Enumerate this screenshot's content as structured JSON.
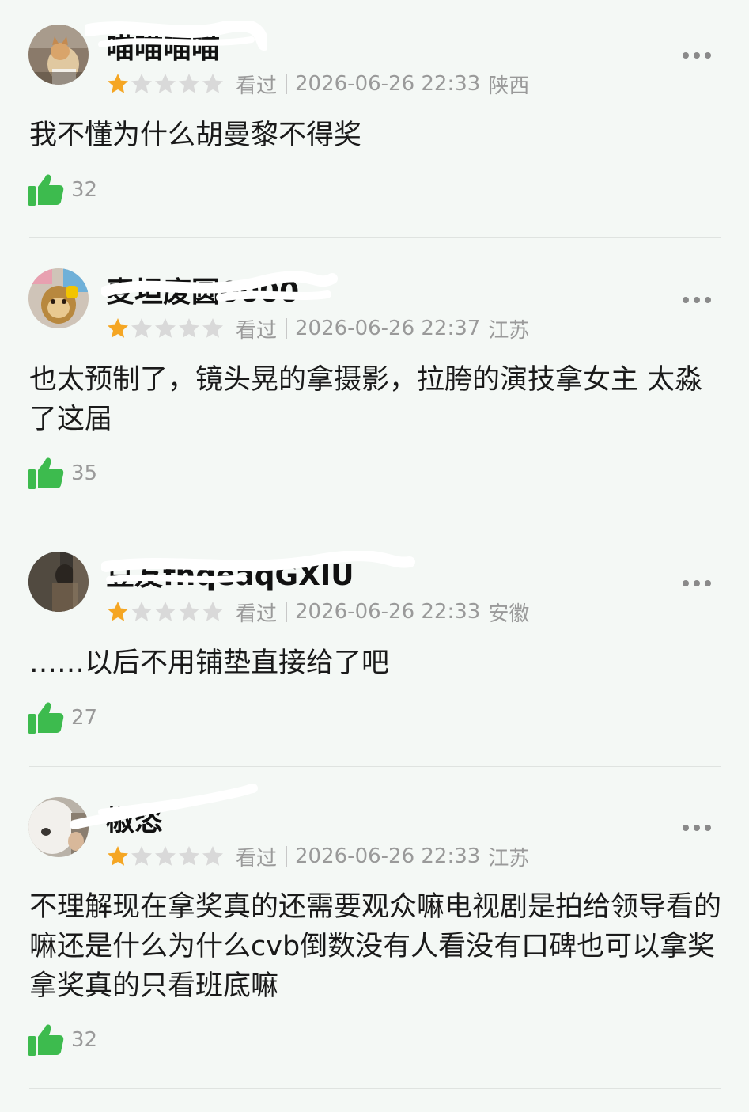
{
  "comments": [
    {
      "username": "喵喵喵喵",
      "status": "看过",
      "time": "2026-06-26 22:33",
      "location": "陕西",
      "rating": 1,
      "rating_max": 5,
      "text": "我不懂为什么胡曼黎不得奖",
      "likes": "32",
      "avatar_icon": "cat-photo-avatar"
    },
    {
      "username": "麦坦废圆0000",
      "status": "看过",
      "time": "2026-06-26 22:37",
      "location": "江苏",
      "rating": 1,
      "rating_max": 5,
      "text": "也太预制了，镜头晃的拿摄影，拉胯的演技拿女主 太淼了这届",
      "likes": "35",
      "avatar_icon": "cartoon-monkey-avatar"
    },
    {
      "username": "豆友fnqeaqGXIU",
      "status": "看过",
      "time": "2026-06-26 22:33",
      "location": "安徽",
      "rating": 1,
      "rating_max": 5,
      "text": "……以后不用铺垫直接给了吧",
      "likes": "27",
      "avatar_icon": "dark-photo-avatar"
    },
    {
      "username": "椒恣",
      "status": "看过",
      "time": "2026-06-26 22:33",
      "location": "江苏",
      "rating": 1,
      "rating_max": 5,
      "text": "不理解现在拿奖真的还需要观众嘛电视剧是拍给领导看的嘛还是什么为什么cvb倒数没有人看没有口碑也可以拿奖拿奖真的只看班底嘛",
      "likes": "32",
      "avatar_icon": "white-animal-avatar"
    }
  ],
  "colors": {
    "star_filled": "#f5a623",
    "star_empty": "#d9d9d9",
    "like_green": "#3dbb4e",
    "meta_gray": "#9a9a9a",
    "background": "#f4f8f5"
  },
  "icons": {
    "star": "star-icon",
    "like": "thumbs-up-icon",
    "more": "more-dots-icon"
  }
}
